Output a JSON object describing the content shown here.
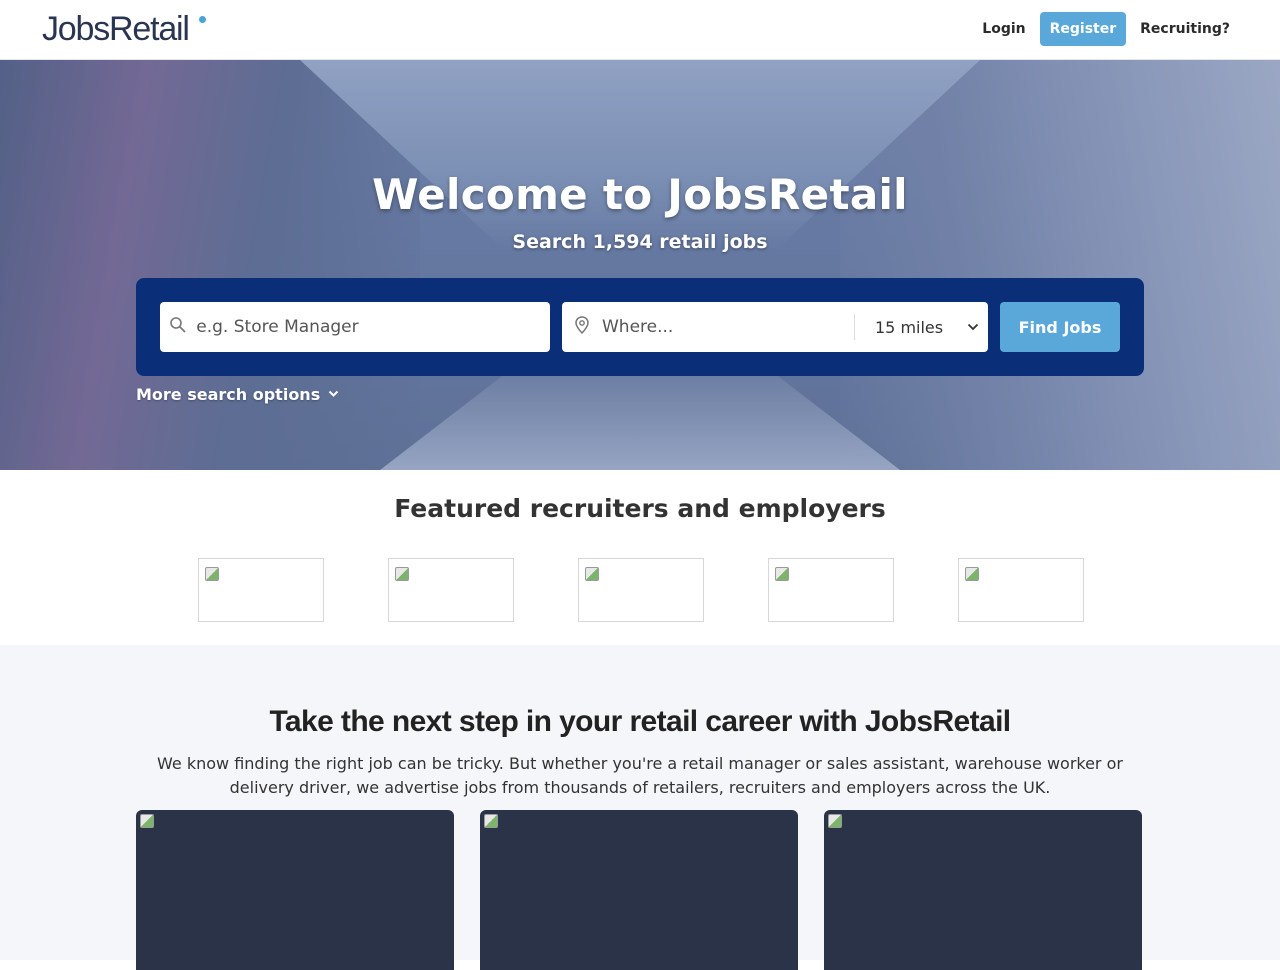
{
  "header": {
    "logo_text": "JobsRetail",
    "nav": {
      "login": "Login",
      "register": "Register",
      "recruiting": "Recruiting?"
    }
  },
  "hero": {
    "title": "Welcome to JobsRetail",
    "subtitle": "Search 1,594 retail jobs",
    "search": {
      "what_placeholder": "e.g. Store Manager",
      "where_placeholder": "Where...",
      "radius": "15 miles",
      "button": "Find Jobs"
    },
    "more_options": "More search options"
  },
  "featured": {
    "title": "Featured recruiters and employers",
    "logos": [
      "broken-image",
      "broken-image",
      "broken-image",
      "broken-image",
      "broken-image"
    ]
  },
  "career": {
    "title": "Take the next step in your retail career with JobsRetail",
    "description": "We know finding the right job can be tricky. But whether you're a retail manager or sales assistant, warehouse worker or delivery driver, we advertise jobs from thousands of retailers, recruiters and employers across the UK."
  },
  "colors": {
    "brand_navy": "#0a2f78",
    "accent_blue": "#5aa7da",
    "logo_text": "#2a3552",
    "card_dark": "#2a3347"
  }
}
